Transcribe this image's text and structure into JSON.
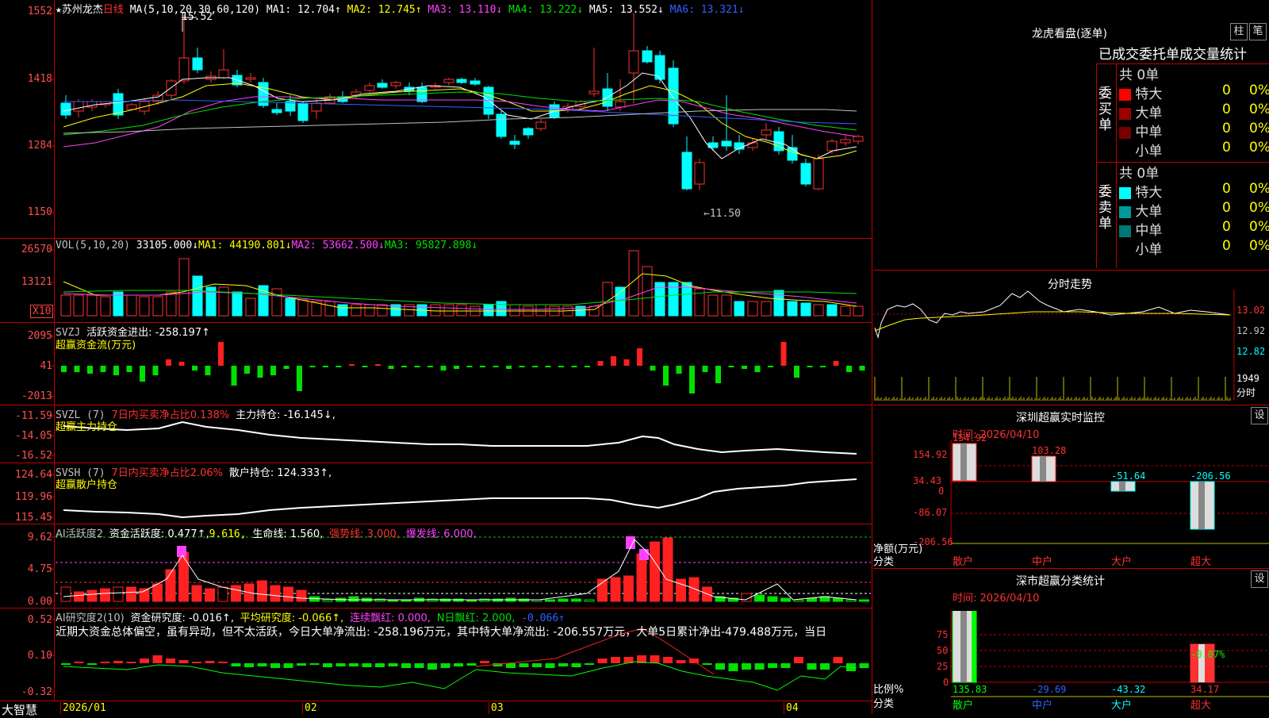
{
  "header": {
    "star": "★",
    "stock_name": "苏州龙杰",
    "period": "日线",
    "ma_label": "MA(5,10,20,30,60,120)",
    "ma1": "MA1: 12.704↑",
    "ma2": "MA2: 12.745↑",
    "ma3": "MA3: 13.110↓",
    "ma4": "MA4: 13.222↓",
    "ma5": "MA5: 13.552↓",
    "ma6": "MA6: 13.321↓"
  },
  "price_axis": [
    "1552",
    "1418",
    "1284",
    "1150"
  ],
  "price_annotations": {
    "high": "15.52",
    "low": "←11.50"
  },
  "vol": {
    "label": "VOL(5,10,20)",
    "value": "33105.000↓",
    "ma1": "MA1: 44190.801↓",
    "ma2": "MA2: 53662.500↓",
    "ma3": "MA3: 95827.898↓",
    "axis": [
      "26570",
      "13121"
    ],
    "unit": "X10"
  },
  "svzj": {
    "label": "SVZJ",
    "text": "活跃资金进出: -258.197↑",
    "subtitle": "超赢资金流(万元)",
    "axis": [
      "2095",
      "41",
      "-2013"
    ]
  },
  "svzl": {
    "label": "SVZL (7)",
    "ratio": "7日内买卖净占比0.138%",
    "holding": "主力持仓: -16.145↓,",
    "subtitle": "超赢主力持仓",
    "axis": [
      "-11.59",
      "-14.05",
      "-16.52"
    ]
  },
  "svsh": {
    "label": "SVSH (7)",
    "ratio": "7日内买卖净占比2.06%",
    "holding": "散户持仓: 124.333↑,",
    "subtitle": "超赢散户持仓",
    "axis": [
      "124.64",
      "119.96",
      "115.45"
    ]
  },
  "ai_active": {
    "label": "AI活跃度2",
    "active": "资金活跃度: 0.477↑,",
    "val2": "9.616,",
    "life": "生命线: 1.560,",
    "strong": "强势线: 3.000,",
    "burst": "爆发线: 6.000,",
    "axis": [
      "9.62",
      "4.75",
      "0.00"
    ]
  },
  "ai_research": {
    "label": "AI研究度2(10)",
    "research": "资金研究度: -0.016↑,",
    "avg": "平均研究度: -0.066↑,",
    "cont": "连续飘红: 0.000,",
    "nday": "N日飘红: 2.000,",
    "last": "-0.066↑",
    "summary": "近期大资金总体偏空，虽有异动，但不太活跃，今日大单净流出: -258.196万元，其中特大单净流出: -206.557万元，大单5日累计净出-479.488万元，当日",
    "axis": [
      "0.52",
      "0.10",
      "-0.32"
    ]
  },
  "x_axis": {
    "brand": "大智慧",
    "labels": [
      "2026/01",
      "02",
      "03",
      "04"
    ]
  },
  "right": {
    "title": "龙虎看盘(逐单)",
    "btn_bar": "柱",
    "btn_pen": "笔",
    "tabs": [
      "已成交",
      "委托单",
      "成交量统计"
    ],
    "buy_title": "委买单",
    "sell_title": "委卖单",
    "buy_total": "共 0单",
    "sell_total": "共 0单",
    "rows": [
      {
        "label": "特大",
        "count": "0",
        "pct": "0%"
      },
      {
        "label": "大单",
        "count": "0",
        "pct": "0%"
      },
      {
        "label": "中单",
        "count": "0",
        "pct": "0%"
      },
      {
        "label": "小单",
        "count": "0",
        "pct": "0%"
      }
    ],
    "colors": {
      "buy": [
        "#ff0000",
        "#990000",
        "#770000"
      ],
      "sell": [
        "#00ffff",
        "#009999",
        "#007777"
      ]
    },
    "intraday_title": "分时走势",
    "intraday_axis": [
      "13.02",
      "12.92",
      "12.82",
      "1949",
      "分时"
    ],
    "sz_title": "深圳超赢实时监控",
    "sz_set": "设",
    "sz_time": "时间: 2026/04/10",
    "sz_axis": [
      "154.92",
      "34.43",
      "0",
      "-86.07",
      "-206.56"
    ],
    "sz_unit": "净额(万元)",
    "sz_cat": "分类",
    "sz_values": [
      {
        "name": "散户",
        "value": "154.92",
        "color": "#ff3030"
      },
      {
        "name": "中户",
        "value": "103.28",
        "color": "#ff3030"
      },
      {
        "name": "大户",
        "value": "-51.64",
        "color": "#00ffff"
      },
      {
        "name": "超大",
        "value": "-206.56",
        "color": "#00ffff"
      }
    ],
    "ss_title": "深市超赢分类统计",
    "ss_set": "设",
    "ss_time": "时间: 2026/04/10",
    "ss_axis": [
      "75",
      "50",
      "25",
      "0"
    ],
    "ss_unit": "比例%",
    "ss_cat": "分类",
    "ss_values": [
      {
        "name": "散户",
        "value": "135.83",
        "color": "#00ff00"
      },
      {
        "name": "中户",
        "value": "-29.69",
        "color": "#3060ff"
      },
      {
        "name": "大户",
        "value": "-43.32",
        "color": "#00ffff"
      },
      {
        "name": "超大",
        "value": "34.17",
        "color": "#ff3030"
      }
    ],
    "ss_extra": "-0.07%"
  }
}
